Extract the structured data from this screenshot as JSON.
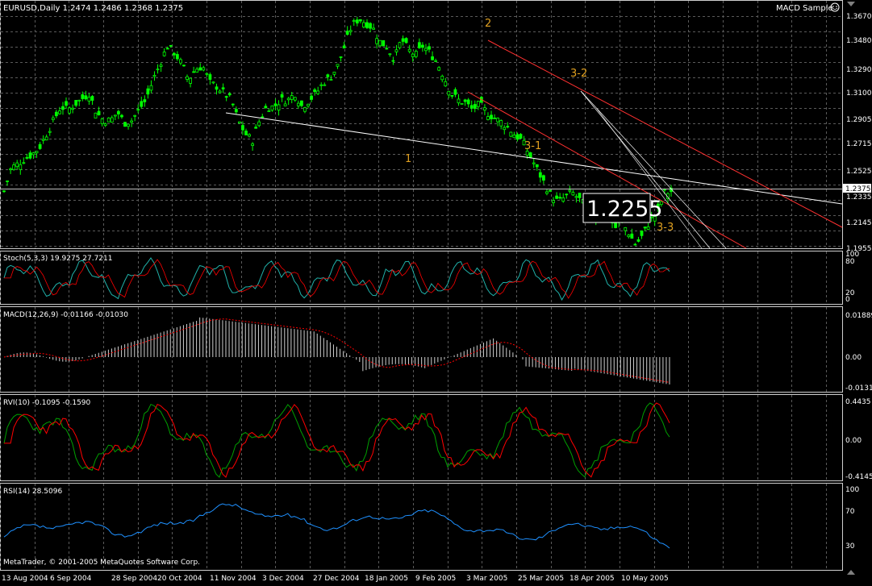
{
  "main": {
    "symbol_info": "EURUSD,Daily  1.2474 1.2486 1.2368 1.2375",
    "expert_label": "MACD Sample",
    "price_axis": [
      "1.3670",
      "1.3480",
      "1.3290",
      "1.3100",
      "1.2905",
      "1.2715",
      "1.2525",
      "1.2375",
      "1.2335",
      "1.2145",
      "1.1955"
    ],
    "current_price": "1.2375",
    "big_price_label": "1.2255",
    "wave_labels": [
      "1",
      "2",
      "3-1",
      "3-2",
      "3-3"
    ]
  },
  "stoch": {
    "label": "Stoch(5,3,3) 19.9275 27.7211",
    "axis": [
      "100",
      "80",
      "20",
      "0"
    ]
  },
  "macd": {
    "label": "MACD(12,26,9) -0.01166 -0.01030",
    "axis": [
      "0.01889",
      "0.00",
      "-0.0131"
    ]
  },
  "rvi": {
    "label": "RVI(10) -0.1095 -0.1590",
    "axis": [
      "0.4435",
      "0.00",
      "-0.4145"
    ]
  },
  "rsi": {
    "label": "RSI(14) 28.5096",
    "axis": [
      "100",
      "70",
      "30"
    ]
  },
  "copyright": "MetaTrader, © 2001-2005 MetaQuotes Software Corp.",
  "time_axis": [
    "13 Aug 2004",
    "6 Sep 2004",
    "28 Sep 2004",
    "20 Oct 2004",
    "11 Nov 2004",
    "3 Dec 2004",
    "27 Dec 2004",
    "18 Jan 2005",
    "9 Feb 2005",
    "3 Mar 2005",
    "25 Mar 2005",
    "18 Apr 2005",
    "10 May 2005"
  ],
  "colors": {
    "bull": "#00ff00",
    "bear": "#00ff00",
    "stoch": "#20b2aa",
    "signal_red": "#ff0000",
    "rvi_green": "#00a000",
    "rsi": "#1e90ff",
    "channel": "#ff3030",
    "trend": "#ffffff",
    "wave": "#e0a020",
    "grid": "#808080"
  },
  "chart_data": {
    "type": "candlestick",
    "title": "EURUSD,Daily",
    "close_series": [
      1.2375,
      1.236,
      1.221,
      1.216,
      1.205,
      1.198,
      1.207,
      1.215,
      1.21,
      1.225,
      1.222,
      1.218,
      1.226,
      1.232,
      1.237,
      1.233,
      1.23,
      1.235,
      1.245,
      1.255,
      1.265,
      1.275,
      1.279,
      1.285,
      1.289,
      1.292,
      1.296,
      1.302,
      1.298,
      1.303,
      1.305,
      1.31,
      1.322,
      1.333,
      1.34,
      1.345,
      1.338,
      1.342,
      1.35,
      1.335,
      1.344,
      1.348,
      1.358,
      1.362,
      1.365,
      1.36,
      1.345,
      1.33,
      1.322,
      1.318,
      1.31,
      1.305,
      1.3,
      1.31,
      1.305,
      1.305,
      1.3,
      1.3,
      1.29,
      1.275,
      1.28,
      1.29,
      1.305,
      1.31,
      1.315,
      1.318,
      1.33,
      1.328,
      1.32,
      1.332,
      1.34,
      1.345,
      1.332,
      1.32,
      1.305,
      1.298,
      1.29,
      1.288,
      1.296,
      1.29,
      1.29,
      1.296,
      1.31,
      1.306,
      1.302,
      1.298,
      1.3,
      1.29,
      1.28,
      1.27,
      1.265,
      1.262,
      1.258,
      1.255,
      1.2375
    ],
    "ylim": [
      1.1955,
      1.367
    ]
  }
}
